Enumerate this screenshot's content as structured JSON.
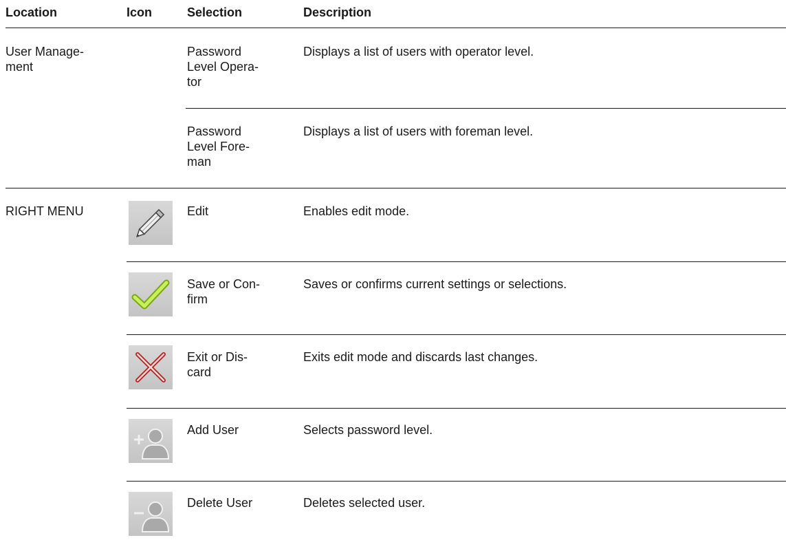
{
  "headers": {
    "location": "Location",
    "icon": "Icon",
    "selection": "Selection",
    "description": "Description"
  },
  "groups": {
    "user_management": {
      "location": "User Manage-\nment",
      "rows": [
        {
          "selection": "Password\nLevel Opera-\ntor",
          "description": "Displays a list of users with operator level."
        },
        {
          "selection": "Password\nLevel Fore-\nman",
          "description": "Displays a list of users with foreman level."
        }
      ]
    },
    "right_menu": {
      "location": "RIGHT MENU",
      "rows": [
        {
          "icon": "pencil-icon",
          "selection": "Edit",
          "description": "Enables edit mode."
        },
        {
          "icon": "checkmark-icon",
          "selection": "Save or Con-\nfirm",
          "description": "Saves or confirms current settings or selections."
        },
        {
          "icon": "cross-icon",
          "selection": "Exit or Dis-\ncard",
          "description": "Exits edit mode and discards last changes."
        },
        {
          "icon": "add-user-icon",
          "selection": "Add User",
          "description": "Selects password level."
        },
        {
          "icon": "delete-user-icon",
          "selection": "Delete User",
          "description": "Deletes selected user."
        }
      ]
    }
  },
  "colors": {
    "check_green": "#9ccf1c",
    "cross_red": "#c9302c",
    "icon_bg": "#cccccc",
    "rule": "#1a1a1a"
  }
}
